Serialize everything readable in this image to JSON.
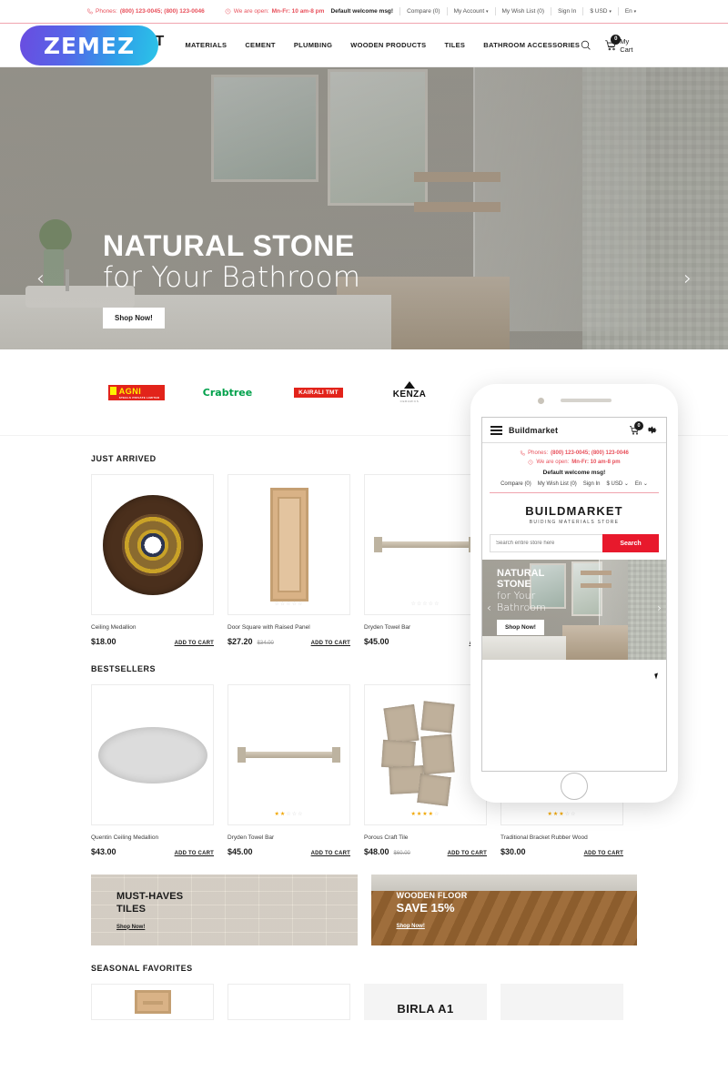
{
  "topbar": {
    "phones_label": "Phones:",
    "phones_value": "(800) 123-0045; (800) 123-0046",
    "hours_label": "We are open:",
    "hours_value": "Mn-Fr: 10 am-8 pm",
    "welcome": "Default welcome msg!",
    "links": [
      {
        "label": "Compare (0)"
      },
      {
        "label": "My Account"
      },
      {
        "label": "My Wish List (0)"
      },
      {
        "label": "Sign In"
      },
      {
        "label": "$ USD"
      },
      {
        "label": "En"
      }
    ]
  },
  "header": {
    "logo_main": "BUILDMARKET",
    "logo_sub": "BUIDING MATERIALS STORE",
    "watermark": "ZEMEZ",
    "nav": [
      {
        "label": "MATERIALS"
      },
      {
        "label": "CEMENT"
      },
      {
        "label": "PLUMBING"
      },
      {
        "label": "WOODEN PRODUCTS"
      },
      {
        "label": "TILES"
      },
      {
        "label": "BATHROOM ACCESSORIES"
      }
    ],
    "cart_count": "0",
    "cart_label": "My Cart"
  },
  "hero": {
    "line1": "NATURAL STONE",
    "line2": "for Your Bathroom",
    "button": "Shop Now!",
    "prev": "‹",
    "next": "›"
  },
  "brands": [
    {
      "name": "AGNI",
      "sub": "STEELS PRIVATE LIMITED"
    },
    {
      "name": "Crabtree"
    },
    {
      "name": "KAIRALI TMT"
    },
    {
      "name": "KENZA",
      "sub": "CERAMICS"
    }
  ],
  "sections": {
    "just_arrived": {
      "title": "JUST ARRIVED",
      "products": [
        {
          "name": "Ceiling Medallion",
          "price": "$18.00",
          "old_price": "",
          "add": "ADD TO CART",
          "rating": 0
        },
        {
          "name": "Door Square with Raised Panel",
          "price": "$27.20",
          "old_price": "$34.00",
          "add": "ADD TO CART",
          "rating": 0
        },
        {
          "name": "Dryden Towel Bar",
          "price": "$45.00",
          "old_price": "",
          "add": "ADD T",
          "rating": 0
        }
      ]
    },
    "bestsellers": {
      "title": "BESTSELLERS",
      "products": [
        {
          "name": "Quentin Ceiling Medallion",
          "price": "$43.00",
          "old_price": "",
          "add": "ADD TO CART",
          "rating": 0
        },
        {
          "name": "Dryden Towel Bar",
          "price": "$45.00",
          "old_price": "",
          "add": "ADD TO CART",
          "rating": 2
        },
        {
          "name": "Porous Craft Tile",
          "price": "$48.00",
          "old_price": "$60.00",
          "add": "ADD TO CART",
          "rating": 4
        },
        {
          "name": "Traditional Bracket Rubber Wood",
          "price": "$30.00",
          "old_price": "",
          "add": "ADD TO CART",
          "rating": 3
        }
      ]
    },
    "seasonal": {
      "title": "SEASONAL FAVORITES",
      "birla": "BIRLA A1"
    }
  },
  "promos": [
    {
      "line1": "MUST-HAVES",
      "line2": "TILES",
      "link": "Shop Now!"
    },
    {
      "line1": "WOODEN FLOOR",
      "line2": "SAVE 15%",
      "link": "Shop Now!"
    }
  ],
  "phone": {
    "title": "Buildmarket",
    "cart_count": "0",
    "phones_label": "Phones:",
    "phones_value": "(800) 123-0045; (800) 123-0046",
    "hours_label": "We are open:",
    "hours_value": "Mn-Fr: 10 am-8 pm",
    "welcome": "Default welcome msg!",
    "links": [
      {
        "label": "Compare (0)"
      },
      {
        "label": "My Wish List (0)"
      },
      {
        "label": "Sign In"
      },
      {
        "label": "$ USD ⌄"
      },
      {
        "label": "En ⌄"
      }
    ],
    "logo_main": "BUILDMARKET",
    "logo_sub": "BUIDING MATERIALS STORE",
    "search_placeholder": "Search entire store here",
    "search_button": "Search",
    "hero_line1": "NATURAL",
    "hero_line1b": "STONE",
    "hero_line2a": "for Your",
    "hero_line2b": "Bathroom",
    "hero_button": "Shop Now!",
    "prev": "‹",
    "next": "›"
  },
  "colors": {
    "accent_red": "#e8505b",
    "search_red": "#e8192c",
    "dark": "#1b1b1b",
    "star": "#f0a500"
  }
}
